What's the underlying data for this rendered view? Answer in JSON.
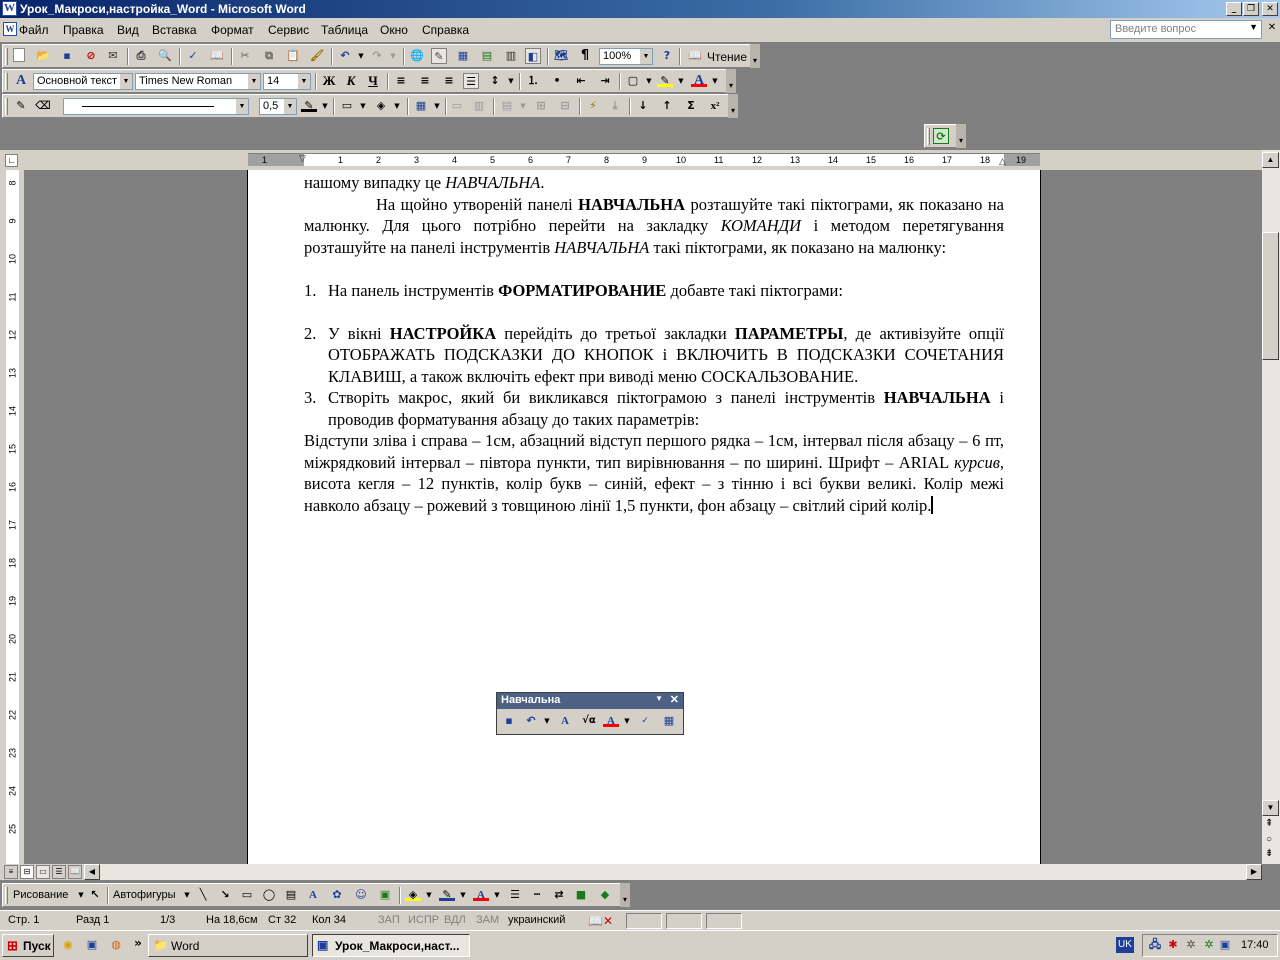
{
  "window": {
    "title": "Урок_Макроси,настройка_Word - Microsoft Word"
  },
  "menu": {
    "items": [
      "Файл",
      "Правка",
      "Вид",
      "Вставка",
      "Формат",
      "Сервис",
      "Таблица",
      "Окно",
      "Справка"
    ],
    "ask_placeholder": "Введите вопрос"
  },
  "toolbar_standard": {
    "zoom": "100%",
    "reading_label": "Чтение"
  },
  "toolbar_formatting": {
    "style": "Основной текст",
    "font": "Times New Roman",
    "size": "14",
    "bold_label": "Ж",
    "italic_label": "К",
    "underline_label": "Ч"
  },
  "toolbar_tables": {
    "line_weight": "0,5"
  },
  "ruler": {
    "h_ticks": [
      "1",
      "1",
      "2",
      "3",
      "4",
      "5",
      "6",
      "7",
      "8",
      "9",
      "10",
      "11",
      "12",
      "13",
      "14",
      "15",
      "16",
      "17",
      "18",
      "19"
    ],
    "v_ticks": [
      "8",
      "9",
      "10",
      "11",
      "12",
      "13",
      "14",
      "15",
      "16",
      "17",
      "18",
      "19",
      "20",
      "21",
      "22",
      "23",
      "24",
      "25"
    ]
  },
  "document": {
    "line0_a": "нашому випадку це ",
    "line0_b": "НАВЧАЛЬНА",
    "line0_c": ".",
    "p1_a": "На щойно утвореній панелі ",
    "p1_b": "НАВЧАЛЬНА",
    "p1_c": " розташуйте такі піктограми, як показано на малюнку. Для цього потрібно перейти на закладку ",
    "p1_d": "КОМАНДИ",
    "p1_e": " і методом перетягування розташуйте на панелі інструментів ",
    "p1_f": "НАВЧАЛЬНА",
    "p1_g": " такі піктограми, як показано на малюнку:",
    "item1_num": "1.",
    "item1_a": "На панель інструментів ",
    "item1_b": "ФОРМАТИРОВАНИЕ",
    "item1_c": " добавте такі піктограми:",
    "item2_num": "2.",
    "item2_a": "У вікні ",
    "item2_b": "НАСТРОЙКА",
    "item2_c": " перейдіть до третьої закладки ",
    "item2_d": "ПАРАМЕТРЫ",
    "item2_e": ", де активізуйте опції ОТОБРАЖАТЬ ПОДСКАЗКИ ДО КНОПОК і ВКЛЮЧИТЬ В ПОДСКАЗКИ СОЧЕТАНИЯ КЛАВИШ, а також включіть ефект при виводі меню СОСКАЛЬЗОВАНИЕ.",
    "item3_num": "3.",
    "item3_a": "Створіть макрос, який би викликався піктограмою з панелі інструментів ",
    "item3_b": "НАВЧАЛЬНА",
    "item3_c": " і проводив форматування абзацу до таких параметрів:",
    "p2_a": "Відступи зліва і справа – 1см, абзацний відступ першого рядка – 1см, інтервал після абзацу – 6 пт, міжрядковий інтервал – півтора пункти, тип вирівнювання – по ширині. Шрифт – ARIAL ",
    "p2_b": "курсив",
    "p2_c": ", висота кегля – 12 пунктів, колір букв – синій, ефект – з тінню і всі букви великі. Колір межі навколо абзацу – рожевий з товщиною лінії 1,5 пункти, фон абзацу – світлий сірий колір."
  },
  "floating_toolbar": {
    "title": "Навчальна"
  },
  "drawing": {
    "draw_label": "Рисование",
    "autoshapes_label": "Автофигуры"
  },
  "status": {
    "page": "Стр. 1",
    "section": "Разд 1",
    "pages": "1/3",
    "at": "На 18,6см",
    "line": "Ст 32",
    "col": "Кол 34",
    "rec": "ЗАП",
    "trk": "ИСПР",
    "ext": "ВДЛ",
    "ovr": "ЗАМ",
    "lang": "украинский"
  },
  "taskbar": {
    "start": "Пуск",
    "task1": "Word",
    "task2": "Урок_Макроси,наст...",
    "lang": "UK",
    "clock": "17:40"
  },
  "colors": {
    "title_start": "#0a246a",
    "title_end": "#a6caf0",
    "chrome": "#d4d0c8",
    "font_color_red": "#ff0000",
    "highlight_yellow": "#ffff00"
  }
}
